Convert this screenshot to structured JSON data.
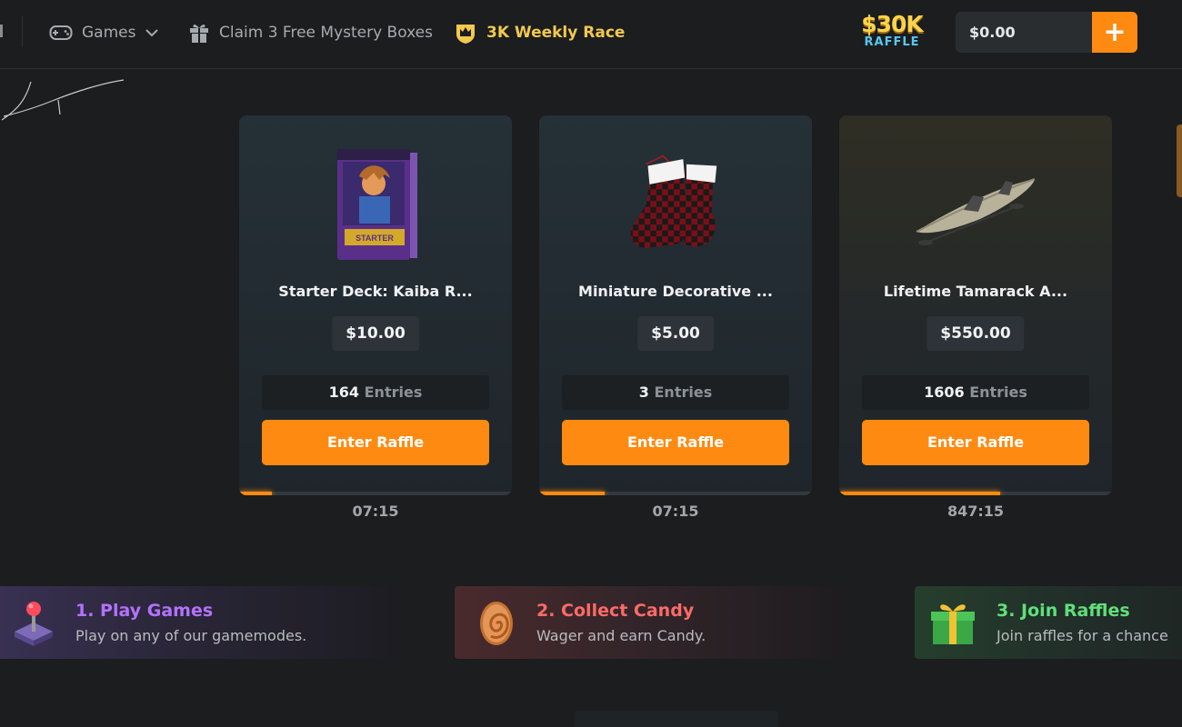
{
  "header": {
    "nav": {
      "games": "Games",
      "mystery_boxes": "Claim 3 Free Mystery Boxes",
      "weekly_race": "3K Weekly Race"
    },
    "raffle_logo": {
      "amount": "$30K",
      "label": "RAFFLE"
    },
    "balance": "$0.00",
    "add_funds": "+"
  },
  "raffles": [
    {
      "name": "Starter Deck: Kaiba R...",
      "price": "$10.00",
      "entries_count": "164",
      "entries_label": "Entries",
      "button": "Enter Raffle",
      "timer": "07:15",
      "progress": 0.12,
      "image": "trading-card-deck"
    },
    {
      "name": "Miniature Decorative ...",
      "price": "$5.00",
      "entries_count": "3",
      "entries_label": "Entries",
      "button": "Enter Raffle",
      "timer": "07:15",
      "progress": 0.24,
      "image": "plaid-stockings"
    },
    {
      "name": "Lifetime Tamarack A...",
      "price": "$550.00",
      "entries_count": "1606",
      "entries_label": "Entries",
      "button": "Enter Raffle",
      "timer": "847:15",
      "progress": 0.59,
      "image": "kayak"
    }
  ],
  "steps": [
    {
      "title": "1. Play Games",
      "desc": "Play on any of our gamemodes.",
      "icon": "joystick-icon"
    },
    {
      "title": "2. Collect Candy",
      "desc": "Wager and earn Candy.",
      "icon": "candy-icon"
    },
    {
      "title": "3. Join Raffles",
      "desc": "Join raffles for a chance",
      "icon": "gift-icon"
    }
  ],
  "colors": {
    "accent": "#ff8a12",
    "background": "#1b1d1f",
    "race_gold": "#f2c94c",
    "step1": "#b372ff",
    "step2": "#ff6b67",
    "step3": "#5fe07a"
  }
}
